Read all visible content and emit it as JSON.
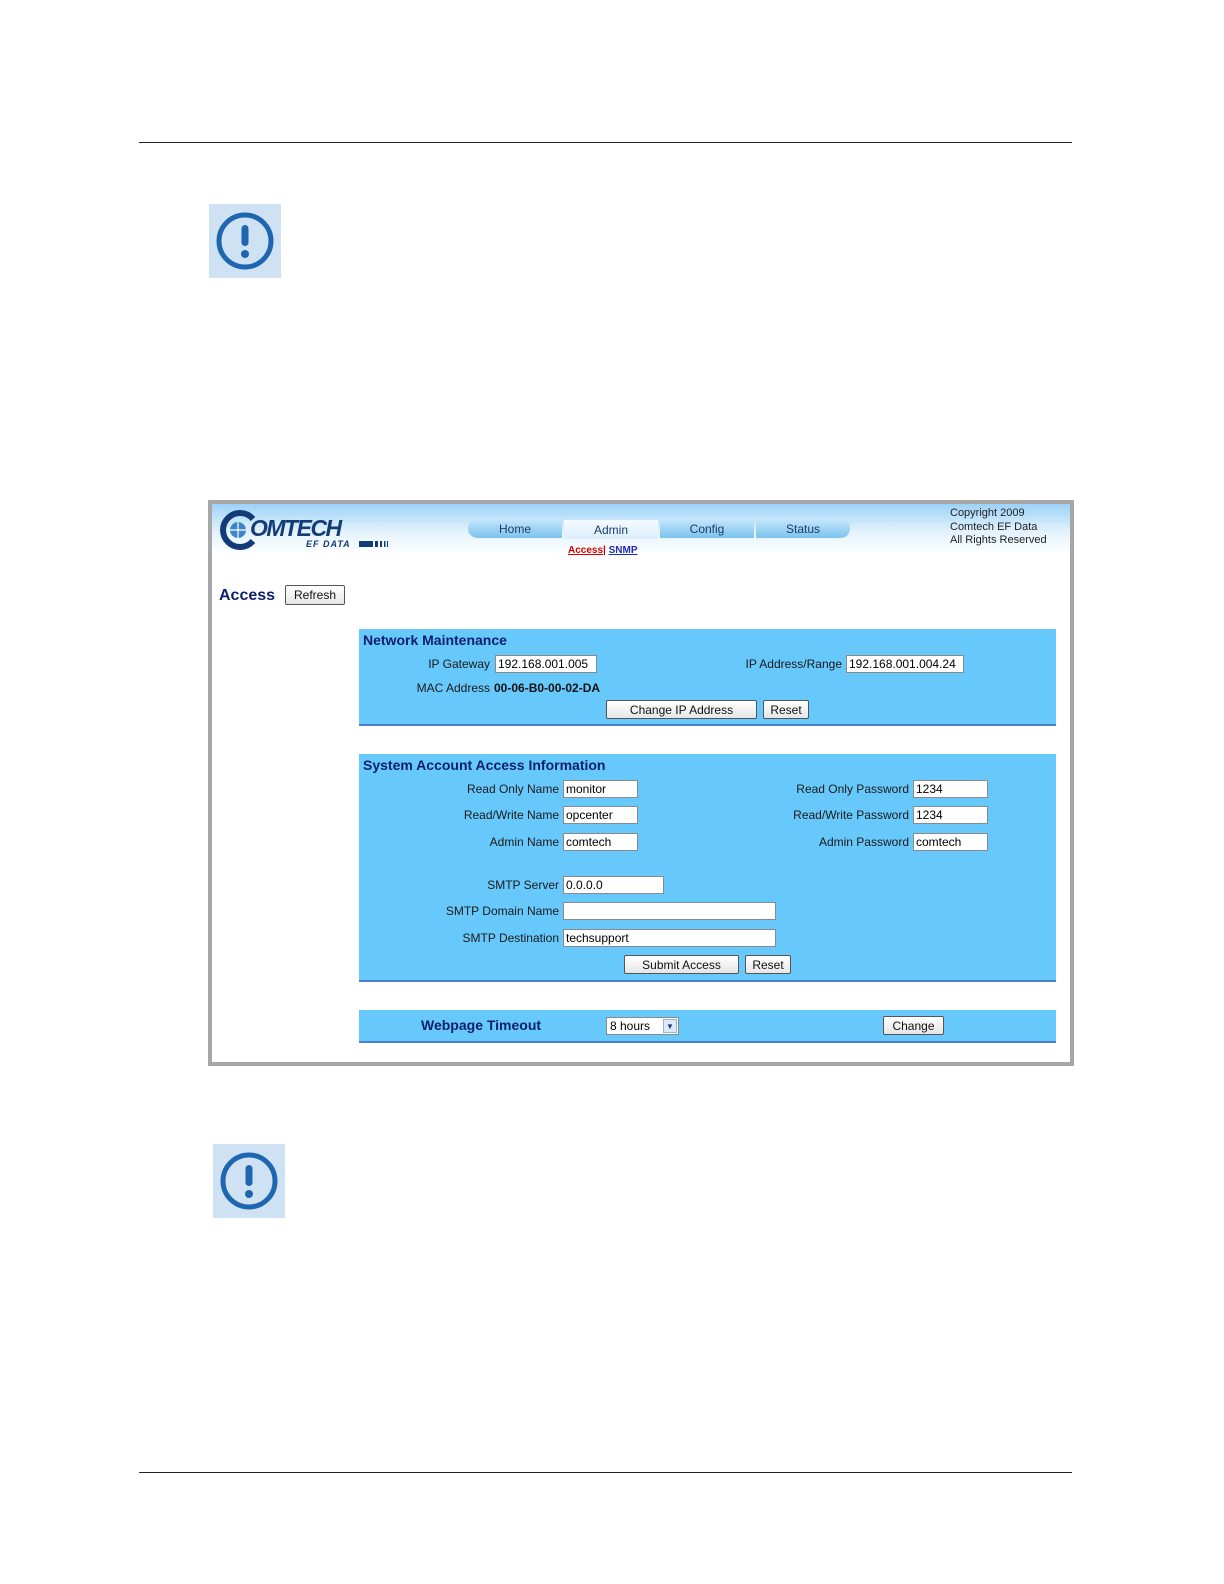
{
  "header": {
    "logo_text": "OMTECH",
    "logo_sub": "EF DATA",
    "tabs": [
      {
        "label": "Home"
      },
      {
        "label": "Admin"
      },
      {
        "label": "Config"
      },
      {
        "label": "Status"
      }
    ],
    "active_tab": "Admin",
    "subnav": {
      "active": "Access",
      "separator": "|",
      "other": "SNMP"
    },
    "copyright": [
      "Copyright 2009",
      "Comtech EF Data",
      "All Rights Reserved"
    ]
  },
  "page": {
    "title": "Access",
    "refresh_label": "Refresh"
  },
  "network": {
    "title": "Network Maintenance",
    "gateway_label": "IP Gateway",
    "gateway_value": "192.168.001.005",
    "address_label": "IP Address/Range",
    "address_value": "192.168.001.004.24",
    "mac_label": "MAC Address",
    "mac_value": "00-06-B0-00-02-DA",
    "change_label": "Change IP Address",
    "reset_label": "Reset"
  },
  "account": {
    "title": "System Account Access Information",
    "ro_name_label": "Read Only Name",
    "ro_name_value": "monitor",
    "rw_name_label": "Read/Write Name",
    "rw_name_value": "opcenter",
    "admin_name_label": "Admin Name",
    "admin_name_value": "comtech",
    "ro_pass_label": "Read Only Password",
    "ro_pass_value": "1234",
    "rw_pass_label": "Read/Write Password",
    "rw_pass_value": "1234",
    "admin_pass_label": "Admin Password",
    "admin_pass_value": "comtech",
    "smtp_server_label": "SMTP Server",
    "smtp_server_value": "0.0.0.0",
    "smtp_domain_label": "SMTP Domain Name",
    "smtp_domain_value": "",
    "smtp_dest_label": "SMTP Destination",
    "smtp_dest_value": "techsupport",
    "submit_label": "Submit Access",
    "reset_label": "Reset"
  },
  "timeout": {
    "title": "Webpage Timeout",
    "selected": "8 hours",
    "change_label": "Change"
  },
  "colors": {
    "panel": "#67c8fb",
    "title_text": "#0c1f6b",
    "active_link": "#d40000",
    "link": "#1b2cb5",
    "note_icon_bg": "#cfe2f3",
    "note_icon_fg": "#1f66b0"
  },
  "icons": [
    "important-note-icon",
    "chevron-down-icon",
    "globe-icon"
  ]
}
